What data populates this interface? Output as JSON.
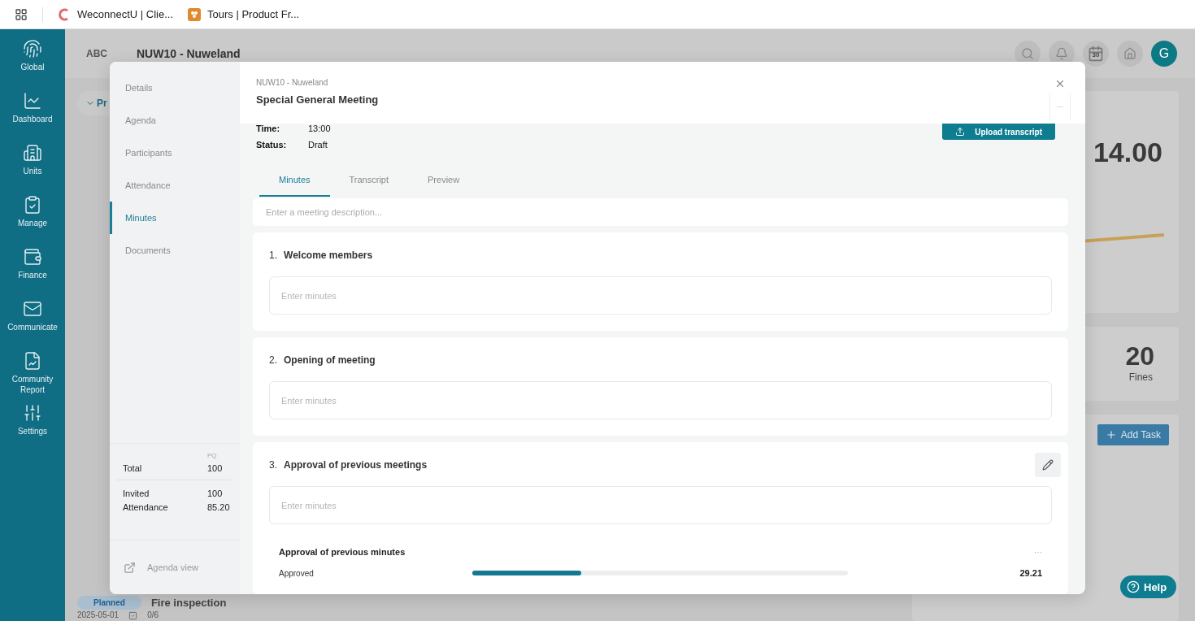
{
  "browser": {
    "bookmarks": [
      {
        "label": "WeconnectU | Clie...",
        "kind": "c"
      },
      {
        "label": "Tours | Product Fr...",
        "kind": "grapes"
      }
    ]
  },
  "sidebar": {
    "items": [
      {
        "label": "Global",
        "kind": "fingerprint"
      },
      {
        "label": "Dashboard",
        "kind": "chart"
      },
      {
        "label": "Units",
        "kind": "building"
      },
      {
        "label": "Manage",
        "kind": "clipboard"
      },
      {
        "label": "Finance",
        "kind": "wallet"
      },
      {
        "label": "Communicate",
        "kind": "mail"
      },
      {
        "label": "Community Report",
        "kind": "report"
      },
      {
        "label": "Settings",
        "kind": "sliders"
      }
    ]
  },
  "header": {
    "logo": "ABC",
    "title": "NUW10 - Nuweland",
    "calendar_day": "30",
    "avatar": "G"
  },
  "background": {
    "filter_chip": "Pr",
    "task": {
      "status": "Planned",
      "title": "Fire inspection",
      "date": "2025-05-01",
      "checklist": "0/6"
    },
    "stat": "14.00",
    "fines": {
      "value": "20",
      "label": "Fines"
    },
    "add_task": "Add Task"
  },
  "modal": {
    "nav": {
      "items": [
        {
          "label": "Details",
          "selected": false
        },
        {
          "label": "Agenda",
          "selected": false
        },
        {
          "label": "Participants",
          "selected": false
        },
        {
          "label": "Attendance",
          "selected": false
        },
        {
          "label": "Minutes",
          "selected": true
        },
        {
          "label": "Documents",
          "selected": false
        }
      ],
      "stats": {
        "column": "PQ",
        "groups": [
          [
            {
              "label": "Total",
              "value": "100"
            }
          ],
          [
            {
              "label": "Invited",
              "value": "100"
            },
            {
              "label": "Attendance",
              "value": "85.20"
            }
          ]
        ]
      },
      "agenda_view": "Agenda view"
    },
    "subtitle": "NUW10 - Nuweland",
    "title": "Special General Meeting",
    "more": "···",
    "details": [
      {
        "label": "Time:",
        "value": "13:00"
      },
      {
        "label": "Status:",
        "value": "Draft"
      }
    ],
    "upload_button": "Upload transcript",
    "tabs": [
      {
        "label": "Minutes",
        "selected": true
      },
      {
        "label": "Transcript",
        "selected": false
      },
      {
        "label": "Preview",
        "selected": false
      }
    ],
    "description": {
      "placeholder": "Enter a meeting description..."
    },
    "agenda_items": [
      {
        "number": "1.",
        "title": "Welcome members",
        "placeholder": "Enter minutes",
        "editable": false
      },
      {
        "number": "2.",
        "title": "Opening of meeting",
        "placeholder": "Enter minutes",
        "editable": false
      },
      {
        "number": "3.",
        "title": "Approval of previous meetings",
        "placeholder": "Enter minutes",
        "editable": true,
        "vote": {
          "title": "Approval of previous minutes",
          "more": "···",
          "options": [
            {
              "label": "Approved",
              "level": 0.29,
              "reading": "29.21"
            }
          ]
        }
      }
    ]
  },
  "help": "Help"
}
